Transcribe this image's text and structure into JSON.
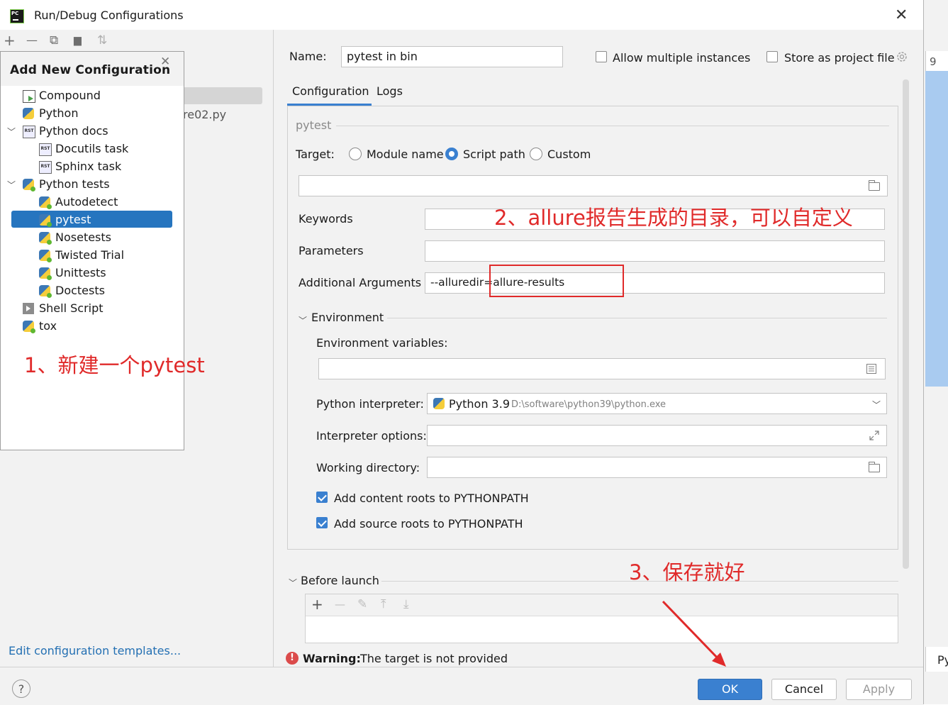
{
  "window": {
    "title": "Run/Debug Configurations",
    "close_glyph": "✕",
    "app_icon_text": "PC"
  },
  "left_toolbar": {
    "add": "+",
    "remove": "—",
    "copy": "⧉",
    "folder": "▆",
    "sort": "⇅"
  },
  "behind_list": {
    "partial_item": "re02.py"
  },
  "popup": {
    "title": "Add New Configuration",
    "close": "✕",
    "items": [
      {
        "label": "Compound",
        "icon": "compound-icon"
      },
      {
        "label": "Python",
        "icon": "python-icon"
      },
      {
        "label": "Python docs",
        "icon": "rst-icon",
        "expanded": true
      },
      {
        "label": "Docutils task",
        "icon": "rst-icon"
      },
      {
        "label": "Sphinx task",
        "icon": "rst-icon"
      },
      {
        "label": "Python tests",
        "icon": "python-tests-icon",
        "expanded": true
      },
      {
        "label": "Autodetect",
        "icon": "python-tests-icon"
      },
      {
        "label": "pytest",
        "icon": "python-tests-icon",
        "selected": true
      },
      {
        "label": "Nosetests",
        "icon": "python-tests-icon"
      },
      {
        "label": "Twisted Trial",
        "icon": "python-tests-icon"
      },
      {
        "label": "Unittests",
        "icon": "python-tests-icon"
      },
      {
        "label": "Doctests",
        "icon": "python-tests-icon"
      },
      {
        "label": "Shell Script",
        "icon": "shell-script-icon"
      },
      {
        "label": "tox",
        "icon": "python-tests-icon"
      }
    ],
    "rst_text": "RST"
  },
  "edit_templates": "Edit configuration templates...",
  "form": {
    "name_label": "Name:",
    "name_value": "pytest in bin",
    "allow_multiple": "Allow multiple instances",
    "store_as_project": "Store as project file",
    "tabs": [
      "Configuration",
      "Logs"
    ],
    "section_pytest": "pytest",
    "target_label": "Target:",
    "target_options": [
      "Module name",
      "Script path",
      "Custom"
    ],
    "target_selected": "Script path",
    "keywords_label": "Keywords",
    "parameters_label": "Parameters",
    "additional_args_label": "Additional Arguments",
    "additional_args_value": "--alluredir=allure-results",
    "environment_section": "Environment",
    "env_vars_label": "Environment variables:",
    "interpreter_label": "Python interpreter:",
    "interpreter_name": "Python 3.9",
    "interpreter_path": "D:\\software\\python39\\python.exe",
    "interpreter_options_label": "Interpreter options:",
    "working_dir_label": "Working directory:",
    "content_roots": "Add content roots to PYTHONPATH",
    "source_roots": "Add source roots to PYTHONPATH",
    "before_launch": "Before launch"
  },
  "before_launch_toolbar": {
    "add": "+",
    "remove": "—",
    "edit": "✎",
    "up": "⤒",
    "down": "⤓"
  },
  "warning": {
    "prefix": "Warning:",
    "text": "The target is not provided",
    "icon_glyph": "!"
  },
  "buttons": {
    "ok": "OK",
    "cancel": "Cancel",
    "apply": "Apply",
    "help": "?"
  },
  "annotations": {
    "step1": "1、新建一个pytest",
    "step2": "2、allure报告生成的目录，可以自定义",
    "step3": "3、保存就好"
  },
  "background": {
    "partial_number": "9",
    "partial_text": "Py"
  },
  "colors": {
    "accent": "#3a80d0",
    "selection": "#2675bf",
    "annotation": "#e02a2a",
    "link": "#2470b3"
  }
}
